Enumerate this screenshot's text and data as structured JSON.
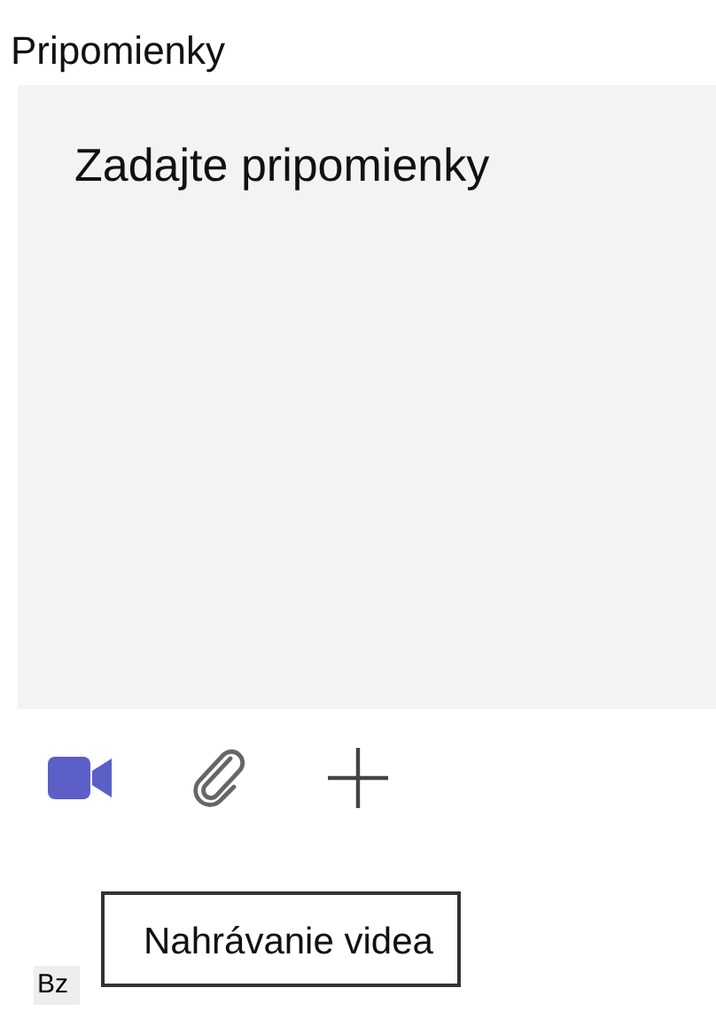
{
  "label": "Pripomienky",
  "comment_field": {
    "placeholder": "Zadajte pripomienky"
  },
  "toolbar": [
    {
      "kind": "video",
      "active": true
    },
    {
      "kind": "attach",
      "active": false
    },
    {
      "kind": "add",
      "active": false
    }
  ],
  "tooltip": "Nahrávanie videa",
  "badge": "Bz"
}
